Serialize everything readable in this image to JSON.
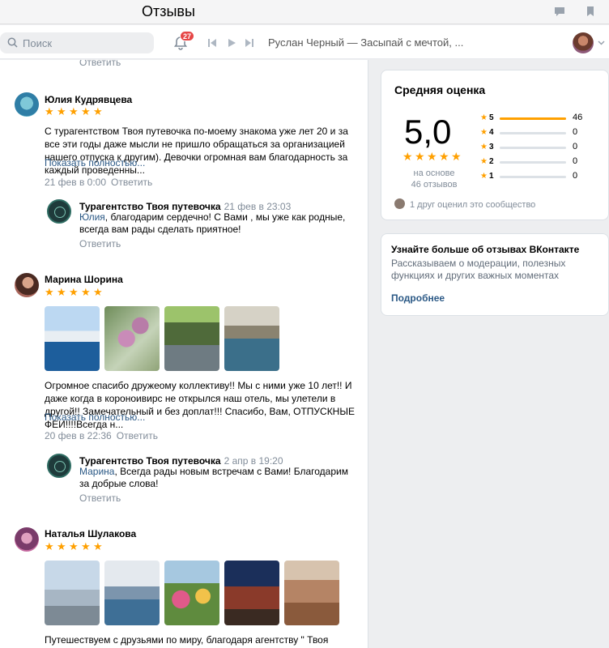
{
  "window": {
    "title": "Отзывы"
  },
  "topnav": {
    "search_placeholder": "Поиск",
    "notifications_count": "27",
    "track": "Руслан Черный — Засыпай с мечтой, ..."
  },
  "feed": {
    "top_reply": "Ответить",
    "reviews": [
      {
        "name": "Юлия Кудрявцева",
        "rating": 5,
        "text": "С турагентством Твоя путевочка по-моему знакома уже лет 20 и за все эти годы даже мысли не пришло обращаться за организацией нашего отпуска к другим). Девочки огромная вам благодарность за каждый проведенны...",
        "more": "Показать полностью...",
        "date": "21 фев в 0:00",
        "reply": "Ответить",
        "answer": {
          "name": "Турагентство Твоя путевочка",
          "date": "21 фев в 23:03",
          "mention": "Юлия",
          "text": ", благодарим сердечно! С Вами , мы уже как родные, всегда вам рады сделать приятное!",
          "reply": "Ответить"
        }
      },
      {
        "name": "Марина Шорина",
        "rating": 5,
        "text": "Огромное спасибо дружеому коллективу!! Мы с ними уже 10 лет!! И даже когда в короноивирс не открылся наш отель, мы улетели в другой!! Замечательный и без доплат!!! Спасибо, Вам, ОТПУСКНЫЕ ФЕИ!!!!Всегда н...",
        "more": "Показать полностью...",
        "date": "20 фев в 22:36",
        "reply": "Ответить",
        "answer": {
          "name": "Турагентство Твоя путевочка",
          "date": "2 апр в 19:20",
          "mention": "Марина",
          "text": ", Всегда рады новым встречам с Вами! Благодарим за добрые слова!",
          "reply": "Ответить"
        }
      },
      {
        "name": "Наталья Шулакова",
        "rating": 5,
        "text": "Путешествуем с друзьями по миру, благодаря агентству \" Твоя путевочка\" ."
      }
    ]
  },
  "rating_card": {
    "title": "Средняя оценка",
    "score": "5,0",
    "based_on": "на основе",
    "reviews_count": "46 отзывов",
    "distribution": [
      {
        "label": "5",
        "count": "46",
        "fraction": 1.0
      },
      {
        "label": "4",
        "count": "0",
        "fraction": 0
      },
      {
        "label": "3",
        "count": "0",
        "fraction": 0
      },
      {
        "label": "2",
        "count": "0",
        "fraction": 0
      },
      {
        "label": "1",
        "count": "0",
        "fraction": 0
      }
    ],
    "friend_text": "1 друг оценил это сообщество"
  },
  "info_card": {
    "title": "Узнайте больше об отзывах ВКонтакте",
    "text": "Рассказываем о модерации, полезных функциях и других важных моментах",
    "link": "Подробнее"
  },
  "colors": {
    "accent": "#2a5885",
    "star": "#ffa000",
    "badge": "#e64646"
  }
}
